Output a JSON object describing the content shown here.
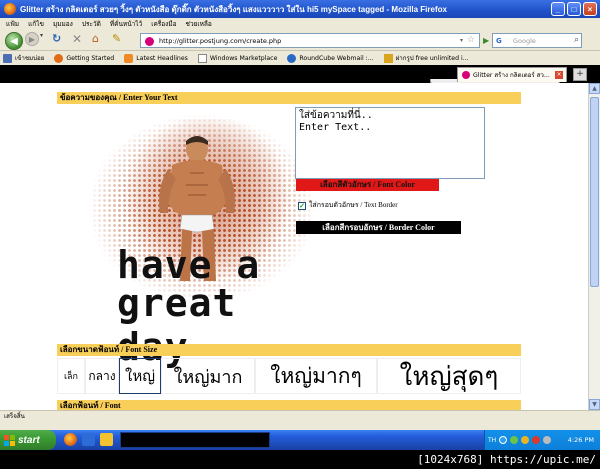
{
  "window": {
    "title": "Glitter สร้าง กลิตเตอร์ สวยๆ วิ้งๆ ตัวหนังสือ ดุ๊กดิ๊ก ตัวหนังสือวิ้งๆ แสงแวววาว ใส่ใน hi5 mySpace tagged - Mozilla Firefox"
  },
  "menubar": {
    "items": [
      "แฟ้ม",
      "แก้ไข",
      "มุมมอง",
      "ประวัติ",
      "ที่คั่นหน้าไว้",
      "เครื่องมือ",
      "ช่วยเหลือ"
    ]
  },
  "navbar": {
    "url": "http://glitter.postjung.com/create.php",
    "search_placeholder": "Google",
    "back_glyph": "◀",
    "forward_glyph": "▶",
    "dropdown_glyph": "▾",
    "reload_glyph": "↻",
    "stop_glyph": "✕",
    "home_glyph": "⌂",
    "edit_glyph": "✎",
    "star_glyph": "☆",
    "go_glyph": "▶",
    "search_engine_glyph": "G",
    "search_glyph": "⌕"
  },
  "bookmarks": {
    "items": [
      {
        "label": "เข้าชมบ่อย",
        "icon": "page-icon",
        "color": "#4a6fb5"
      },
      {
        "label": "Getting Started",
        "icon": "firefox-icon",
        "color": "#e26b16"
      },
      {
        "label": "Latest Headlines",
        "icon": "rss-icon",
        "color": "#f08a24"
      },
      {
        "label": "Windows Marketplace",
        "icon": "page-icon",
        "color": "#ffffff"
      },
      {
        "label": "RoundCube Webmail :...",
        "icon": "roundcube-icon",
        "color": "#2a6ac6"
      },
      {
        "label": "ฝากรูป free unlimited i...",
        "icon": "image-icon",
        "color": "#d9a41e"
      }
    ]
  },
  "tabs": {
    "active_label": "Glitter สร้าง กลิตเตอร์ สว...",
    "close_glyph": "×",
    "new_tab_glyph": "+"
  },
  "page": {
    "section_text_label": "ข้อความของคุณ / Enter Your Text",
    "textarea_value": "ใส่ข้อความที่นี่..\nEnter Text..",
    "font_color_button": "เลือกสีตัวอักษร / Font Color",
    "text_border_label": "ใส่กรอบตัวอักษร / Text Border",
    "text_border_checked": true,
    "border_color_button": "เลือกสีกรอบอักษร / Border Color",
    "greeting_line1": "have a",
    "greeting_line2": "great day",
    "section_size_label": "เลือกขนาดฟ้อนท์ / Font Size",
    "font_sizes": [
      {
        "label": "เล็ก"
      },
      {
        "label": "กลาง"
      },
      {
        "label": "ใหญ่"
      },
      {
        "label": "ใหญ่มาก"
      },
      {
        "label": "ใหญ่มากๆ"
      },
      {
        "label": "ใหญ่สุดๆ"
      }
    ],
    "selected_size": "ใหญ่",
    "section_font_label": "เลือกฟ้อนท์ / Font",
    "colors": {
      "section_bar": "#f8cf58",
      "font_color_button": "#e01818",
      "border_color_button": "#000000"
    }
  },
  "statusbar": {
    "text": "เสร็จสิ้น"
  },
  "taskbar": {
    "start_label": "start",
    "tray_lang": "TH",
    "clock": "4:26 PM"
  },
  "watermark": {
    "text": "[1024x768] https://upic.me/"
  }
}
